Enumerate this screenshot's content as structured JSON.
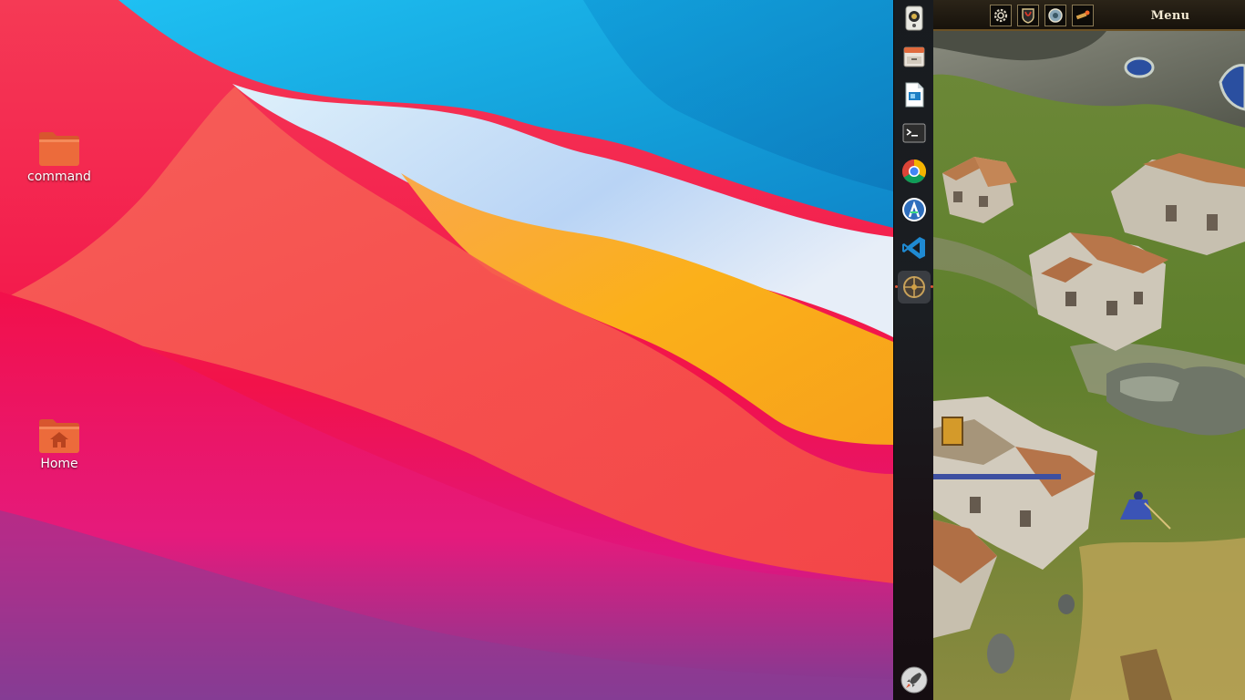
{
  "desktop": {
    "icons": [
      {
        "label": "command",
        "icon": "folder-icon"
      },
      {
        "label": "Home",
        "icon": "home-folder-icon"
      }
    ]
  },
  "dock": {
    "items": [
      {
        "name": "rhythmbox-speaker-icon",
        "active": false
      },
      {
        "name": "files-drawer-icon",
        "active": false
      },
      {
        "name": "libreoffice-impress-icon",
        "active": false
      },
      {
        "name": "terminal-icon",
        "active": false
      },
      {
        "name": "chrome-icon",
        "active": false
      },
      {
        "name": "android-studio-icon",
        "active": false
      },
      {
        "name": "vscode-icon",
        "active": false
      },
      {
        "name": "game-crosshair-icon",
        "active": true
      },
      {
        "name": "launcher-rocket-icon",
        "active": false
      }
    ],
    "running_indicator_color": "#e05a3a"
  },
  "game": {
    "menu_label": "Menu",
    "buttons": [
      "settings-gear-icon",
      "diplomacy-shield-icon",
      "tech-tree-icon",
      "signal-flare-icon"
    ]
  },
  "colors": {
    "wallpaper_red": "#f4304f",
    "wallpaper_blue": "#17a7e3",
    "wallpaper_orange": "#f9b018",
    "folder_orange": "#e8683a"
  }
}
